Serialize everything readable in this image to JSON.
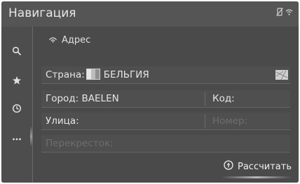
{
  "header": {
    "title": "Навигация"
  },
  "status_icons": [
    "phone-off-icon",
    "wifi-icon"
  ],
  "sidebar": {
    "items": [
      {
        "icon": "search-icon"
      },
      {
        "icon": "star-icon"
      },
      {
        "icon": "history-icon"
      },
      {
        "icon": "more-icon"
      }
    ]
  },
  "section": {
    "icon": "address-icon",
    "label": "Адрес"
  },
  "form": {
    "country_label": "Страна:",
    "country_value": "БЕЛЬГИЯ",
    "map_icon": "map-icon",
    "city_label": "Город:",
    "city_value": "BAELEN",
    "code_label": "Код:",
    "street_label": "Улица:",
    "number_label": "Номер:",
    "intersection_label": "Перекресток:"
  },
  "actions": {
    "calculate_label": "Рассчитать",
    "calculate_icon": "route-icon"
  }
}
